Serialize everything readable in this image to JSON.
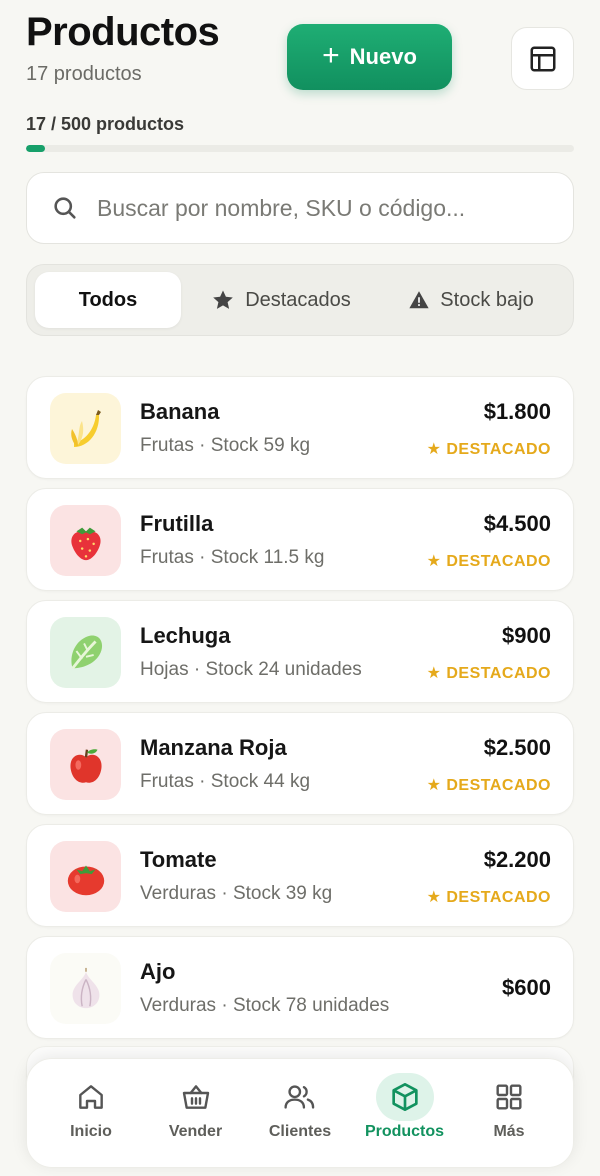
{
  "header": {
    "title": "Productos",
    "subtitle": "17 productos",
    "new_button": "Nuevo"
  },
  "capacity": {
    "label": "17 / 500 productos",
    "fraction": 0.034,
    "color": "#17a06a"
  },
  "search": {
    "placeholder": "Buscar por nombre, SKU o código..."
  },
  "filters": [
    {
      "label": "Todos",
      "icon": "none",
      "active": true
    },
    {
      "label": "Destacados",
      "icon": "star-icon",
      "active": false
    },
    {
      "label": "Stock bajo",
      "icon": "warning-icon",
      "active": false
    }
  ],
  "products": [
    {
      "name": "Banana",
      "category": "Frutas",
      "stock": "Stock 59 kg",
      "price": "$1.800",
      "badge": "★ DESTACADO",
      "icon": "banana-icon"
    },
    {
      "name": "Frutilla",
      "category": "Frutas",
      "stock": "Stock 11.5 kg",
      "price": "$4.500",
      "badge": "★ DESTACADO",
      "icon": "strawberry-icon"
    },
    {
      "name": "Lechuga",
      "category": "Hojas",
      "stock": "Stock 24 unidades",
      "price": "$900",
      "badge": "★ DESTACADO",
      "icon": "lettuce-icon"
    },
    {
      "name": "Manzana Roja",
      "category": "Frutas",
      "stock": "Stock 44 kg",
      "price": "$2.500",
      "badge": "★ DESTACADO",
      "icon": "apple-icon"
    },
    {
      "name": "Tomate",
      "category": "Verduras",
      "stock": "Stock 39 kg",
      "price": "$2.200",
      "badge": "★ DESTACADO",
      "icon": "tomato-icon"
    },
    {
      "name": "Ajo",
      "category": "Verduras",
      "stock": "Stock 78 unidades",
      "price": "$600",
      "badge": "",
      "icon": "garlic-icon"
    }
  ],
  "nav": [
    {
      "label": "Inicio",
      "icon": "home-icon",
      "active": false
    },
    {
      "label": "Vender",
      "icon": "basket-icon",
      "active": false
    },
    {
      "label": "Clientes",
      "icon": "users-icon",
      "active": false
    },
    {
      "label": "Productos",
      "icon": "box-icon",
      "active": true
    },
    {
      "label": "Más",
      "icon": "grid-icon",
      "active": false
    }
  ],
  "colors": {
    "accent": "#12925f",
    "badge": "#e5a91b"
  }
}
